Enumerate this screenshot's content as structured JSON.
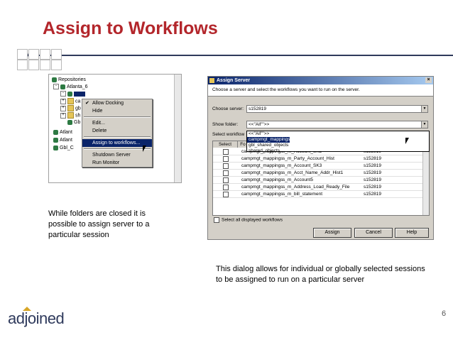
{
  "slide": {
    "title": "Assign to Workflows",
    "page_number": "6",
    "logo_text": "adjoined"
  },
  "tree": {
    "root": "Repositories",
    "repo": "Atlanta_6",
    "rows": [
      "ca",
      "gb",
      "sh",
      "Gb",
      "Atlant",
      "Atlant",
      "Gbl_C"
    ],
    "context_menu": [
      "Allow Docking",
      "Hide",
      "Edit...",
      "Delete",
      "Assign to workflows...",
      "Shutdown Server",
      "Run Monitor"
    ]
  },
  "captions": {
    "left": "While folders are closed it is possible to assign server to a particular session",
    "right": "This dialog allows for individual or globally selected sessions to be assigned to run on a particular server"
  },
  "dialog": {
    "title": "Assign Server",
    "instruction": "Choose a server and select the workflows you want to run on the server.",
    "server_label": "Choose server:",
    "server_value": "s152819",
    "folder_label": "Show folder:",
    "folder_value": "<<\"All\"\">>",
    "workflows_label": "Select workflow",
    "columns": [
      "Select",
      "Fo",
      "",
      ""
    ],
    "dropdown_options": [
      "<<\"All\"\">>",
      "campmgt_mappings",
      "gbl_shared_objects",
      "shared_objects"
    ],
    "rows": [
      {
        "folder": "campmgt_mappings",
        "workflow": "s_m_Account_SK2",
        "server": "s152819"
      },
      {
        "folder": "campmgt_mappings",
        "workflow": "s_m_Party_Account_Hist",
        "server": "s152819"
      },
      {
        "folder": "campmgt_mappings",
        "workflow": "s_m_Account_SK3",
        "server": "s152819"
      },
      {
        "folder": "campmgt_mappings",
        "workflow": "s_m_Acct_Name_Addr_Hist1",
        "server": "s152819"
      },
      {
        "folder": "campmgt_mappings",
        "workflow": "s_m_Account5",
        "server": "s152819"
      },
      {
        "folder": "campmgt_mappings",
        "workflow": "s_m_Address_Load_Ready_File",
        "server": "s152819"
      },
      {
        "folder": "campmgt_mappings",
        "workflow": "s_m_bill_statement",
        "server": "s152819"
      }
    ],
    "select_all_label": "Select all displayed workflows",
    "buttons": {
      "assign": "Assign",
      "cancel": "Cancel",
      "help": "Help"
    }
  }
}
